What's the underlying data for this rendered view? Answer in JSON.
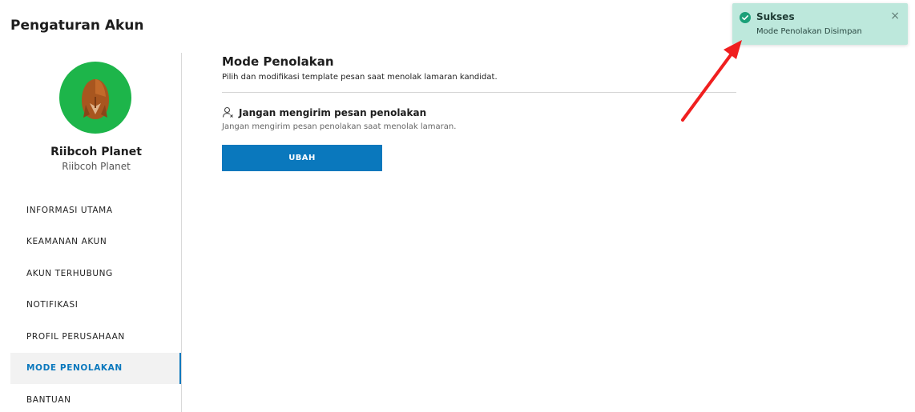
{
  "header": {
    "title": "Pengaturan Akun"
  },
  "profile": {
    "name": "Riibcoh Planet",
    "subtitle": "Riibcoh Planet",
    "avatar_bg": "#1db54a"
  },
  "sidebar": {
    "items": [
      {
        "label": "INFORMASI UTAMA",
        "active": false
      },
      {
        "label": "KEAMANAN AKUN",
        "active": false
      },
      {
        "label": "AKUN TERHUBUNG",
        "active": false
      },
      {
        "label": "NOTIFIKASI",
        "active": false
      },
      {
        "label": "PROFIL PERUSAHAAN",
        "active": false
      },
      {
        "label": "MODE PENOLAKAN",
        "active": true
      },
      {
        "label": "BANTUAN",
        "active": false
      }
    ]
  },
  "main": {
    "title": "Mode Penolakan",
    "description": "Pilih dan modifikasi template pesan saat menolak lamaran kandidat.",
    "option": {
      "icon": "user-x-icon",
      "title": "Jangan mengirim pesan penolakan",
      "description": "Jangan mengirim pesan penolakan saat menolak lamaran."
    },
    "button_label": "UBAH"
  },
  "toast": {
    "title": "Sukses",
    "message": "Mode Penolakan Disimpan",
    "icon": "check-circle-icon",
    "close": "×",
    "bg": "#bde8dc"
  },
  "colors": {
    "accent": "#0a78bd",
    "success": "#1aa078",
    "annotation": "#f01f1f"
  }
}
